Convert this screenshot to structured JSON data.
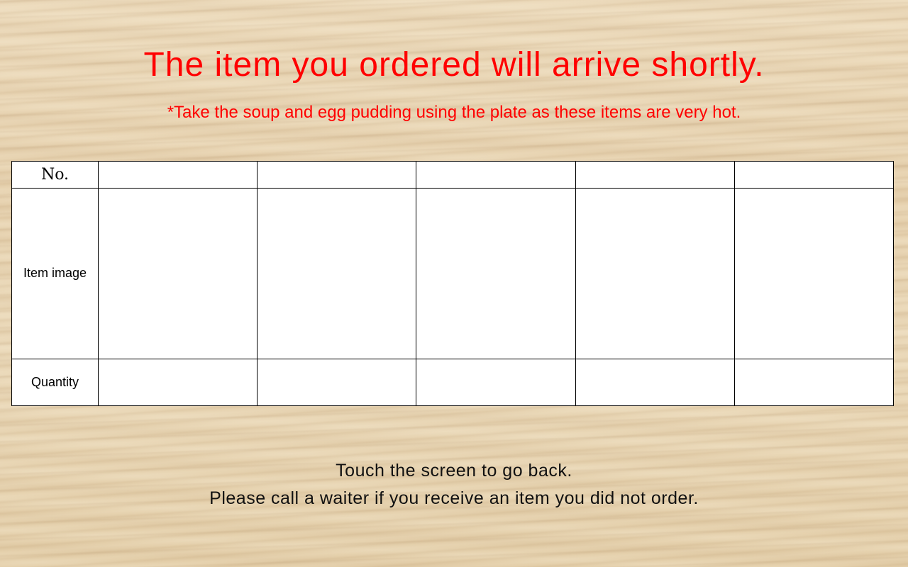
{
  "header": {
    "title": "The item you ordered will arrive shortly.",
    "notice": "*Take the soup and egg pudding using the plate as these items are very hot."
  },
  "order_table": {
    "row_labels": {
      "number": "No.",
      "image": "Item image",
      "quantity": "Quantity"
    },
    "items": [
      {
        "number": "",
        "quantity": ""
      },
      {
        "number": "",
        "quantity": ""
      },
      {
        "number": "",
        "quantity": ""
      },
      {
        "number": "",
        "quantity": ""
      },
      {
        "number": "",
        "quantity": ""
      }
    ]
  },
  "footer": {
    "instruction": "Touch the screen to go back.",
    "warning": "Please call a waiter if you receive an item you did not order."
  },
  "colors": {
    "title": "#ff0000",
    "notice": "#ff0000",
    "table_background": "#ffffff",
    "table_border": "#000000",
    "background": "#e9d6b4"
  }
}
